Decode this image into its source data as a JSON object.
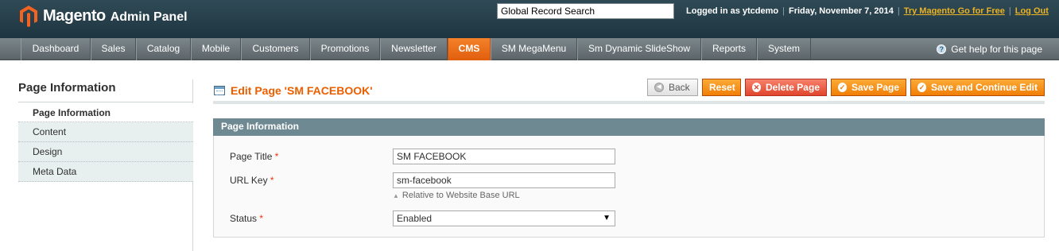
{
  "header": {
    "logo_text": "Magento",
    "logo_sub": "Admin Panel",
    "search_value": "Global Record Search",
    "logged_in": "Logged in as ytcdemo",
    "date": "Friday, November 7, 2014",
    "try_link": "Try Magento Go for Free",
    "logout": "Log Out",
    "separator": "|"
  },
  "nav": {
    "items": [
      {
        "label": "Dashboard"
      },
      {
        "label": "Sales"
      },
      {
        "label": "Catalog"
      },
      {
        "label": "Mobile"
      },
      {
        "label": "Customers"
      },
      {
        "label": "Promotions"
      },
      {
        "label": "Newsletter"
      },
      {
        "label": "CMS",
        "active": true
      },
      {
        "label": "SM MegaMenu"
      },
      {
        "label": "Sm Dynamic SlideShow"
      },
      {
        "label": "Reports"
      },
      {
        "label": "System"
      }
    ],
    "help": "Get help for this page"
  },
  "sidebar": {
    "title": "Page Information",
    "tabs": [
      "Page Information",
      "Content",
      "Design",
      "Meta Data"
    ]
  },
  "main": {
    "heading": "Edit Page 'SM FACEBOOK'",
    "buttons": {
      "back": "Back",
      "reset": "Reset",
      "delete": "Delete Page",
      "save": "Save Page",
      "save_continue": "Save and Continue Edit"
    },
    "fieldset_title": "Page Information",
    "fields": {
      "page_title_label": "Page Title",
      "page_title_value": "SM FACEBOOK",
      "url_key_label": "URL Key",
      "url_key_value": "sm-facebook",
      "url_note": "Relative to Website Base URL",
      "status_label": "Status",
      "status_value": "Enabled",
      "required_mark": "*"
    }
  },
  "colors": {
    "accent": "#eb5e00",
    "header_bg": "#2f4a56",
    "nav_active": "#f4812a",
    "fieldset_head": "#6f8992"
  }
}
